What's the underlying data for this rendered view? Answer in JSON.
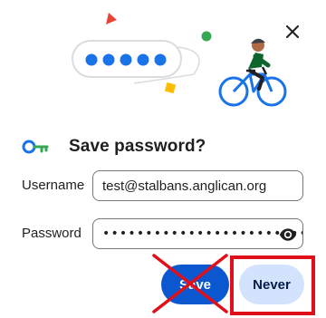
{
  "dialog": {
    "title": "Save password?",
    "close_icon": "close-icon",
    "key_icon": "key-icon",
    "illustration": "password-illustration-cyclist"
  },
  "fields": {
    "username_label": "Username",
    "username_value": "test@stalbans.anglican.org",
    "password_label": "Password",
    "password_value": "••••••••••••••••••••••••",
    "show_password_icon": "eye-icon"
  },
  "buttons": {
    "save_label": "Save",
    "never_label": "Never"
  },
  "annotations": {
    "save_marked": "crossed-out",
    "never_marked": "highlighted"
  },
  "colors": {
    "primary": "#0b57d0",
    "tonal": "#d3e3fd",
    "annotation_red": "#e0101a"
  }
}
